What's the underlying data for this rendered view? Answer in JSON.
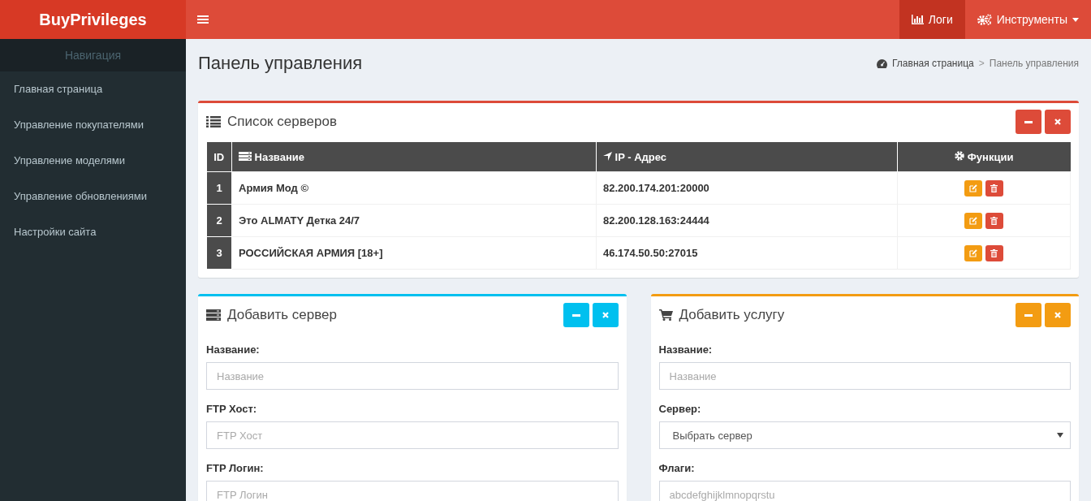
{
  "logo": "BuyPrivileges",
  "topnav": [
    {
      "kind": "logs",
      "label": "Логи",
      "selected": true,
      "dropdown": false
    },
    {
      "kind": "tools",
      "label": "Инструменты",
      "selected": false,
      "dropdown": true
    }
  ],
  "sidebar": {
    "header": "Навигация",
    "items": [
      {
        "label": "Главная страница"
      },
      {
        "label": "Управление покупателями"
      },
      {
        "label": "Управление моделями"
      },
      {
        "label": "Управление обновлениями"
      },
      {
        "label": "Настройки сайта"
      }
    ]
  },
  "page_title": "Панель управления",
  "breadcrumb": {
    "separator": ">",
    "items": [
      "Главная страница",
      "Панель управления"
    ]
  },
  "server_list": {
    "title": "Список серверов",
    "color": "#dd4b39",
    "columns": [
      {
        "kind": "id",
        "label": "ID"
      },
      {
        "kind": "name",
        "label": "Название"
      },
      {
        "kind": "ip",
        "label": "IP - Адрес"
      },
      {
        "kind": "functions",
        "label": "Функции"
      }
    ],
    "rows": [
      {
        "id": "1",
        "name": "Армия Мод ©",
        "ip": "82.200.174.201:20000"
      },
      {
        "id": "2",
        "name": "Это ALMATY Детка 24/7",
        "ip": "82.200.128.163:24444"
      },
      {
        "id": "3",
        "name": "РОССИЙСКАЯ АРМИЯ [18+]",
        "ip": "46.174.50.50:27015"
      }
    ]
  },
  "forms": [
    {
      "kind": "server",
      "title": "Добавить сервер",
      "color": "#00c0ef",
      "fields": [
        {
          "kind": "input",
          "label": "Название:",
          "placeholder": "Название"
        },
        {
          "kind": "input",
          "label": "FTP Хост:",
          "placeholder": "FTP Хост"
        },
        {
          "kind": "input",
          "label": "FTP Логин:",
          "placeholder": "FTP Логин"
        }
      ]
    },
    {
      "kind": "service",
      "title": "Добавить услугу",
      "color": "#f39c12",
      "fields": [
        {
          "kind": "input",
          "label": "Название:",
          "placeholder": "Название"
        },
        {
          "kind": "select",
          "label": "Сервер:",
          "value": "Выбрать сервер"
        },
        {
          "kind": "input",
          "label": "Флаги:",
          "placeholder": "abcdefghijklmnopqrstu"
        }
      ]
    }
  ]
}
